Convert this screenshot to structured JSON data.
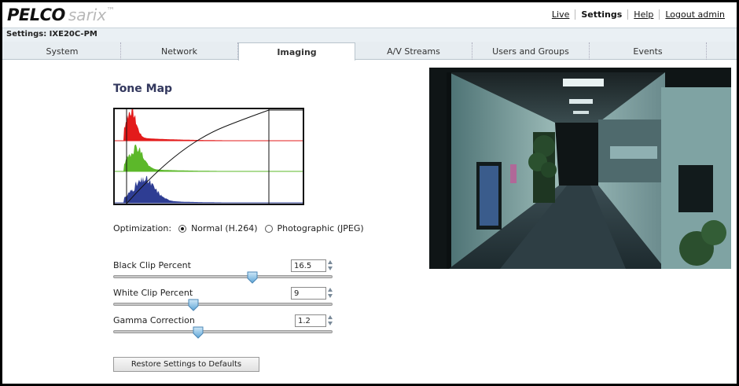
{
  "header": {
    "logo_brand": "PELCO",
    "logo_product": "sarix",
    "logo_tm": "™",
    "nav": [
      {
        "label": "Live",
        "active": false
      },
      {
        "label": "Settings",
        "active": true
      },
      {
        "label": "Help",
        "active": false
      },
      {
        "label": "Logout admin",
        "active": false
      }
    ]
  },
  "settings_title": "Settings: IXE20C-PM",
  "tabs": [
    {
      "label": "System",
      "active": false
    },
    {
      "label": "Network",
      "active": false
    },
    {
      "label": "Imaging",
      "active": true
    },
    {
      "label": "A/V Streams",
      "active": false
    },
    {
      "label": "Users and Groups",
      "active": false
    },
    {
      "label": "Events",
      "active": false
    }
  ],
  "tone_map": {
    "title": "Tone Map",
    "histogram_colors": {
      "red": "#e31b1b",
      "green": "#5cb82a",
      "blue": "#2e3d93",
      "curve": "#111111"
    }
  },
  "optimization": {
    "label": "Optimization:",
    "options": [
      {
        "label": "Normal (H.264)",
        "checked": true
      },
      {
        "label": "Photographic (JPEG)",
        "checked": false
      }
    ]
  },
  "controls": {
    "black_clip": {
      "label": "Black Clip Percent",
      "value": "16.5",
      "fraction": 0.64
    },
    "white_clip": {
      "label": "White Clip Percent",
      "value": "9",
      "fraction": 0.36
    },
    "gamma": {
      "label": "Gamma Correction",
      "value": "1.2",
      "fraction": 0.38
    }
  },
  "restore_button": "Restore Settings to Defaults",
  "colors": {
    "accent": "#33385e",
    "tab_bg": "#e7edf1",
    "settings_bar": "#eaf0f4"
  }
}
